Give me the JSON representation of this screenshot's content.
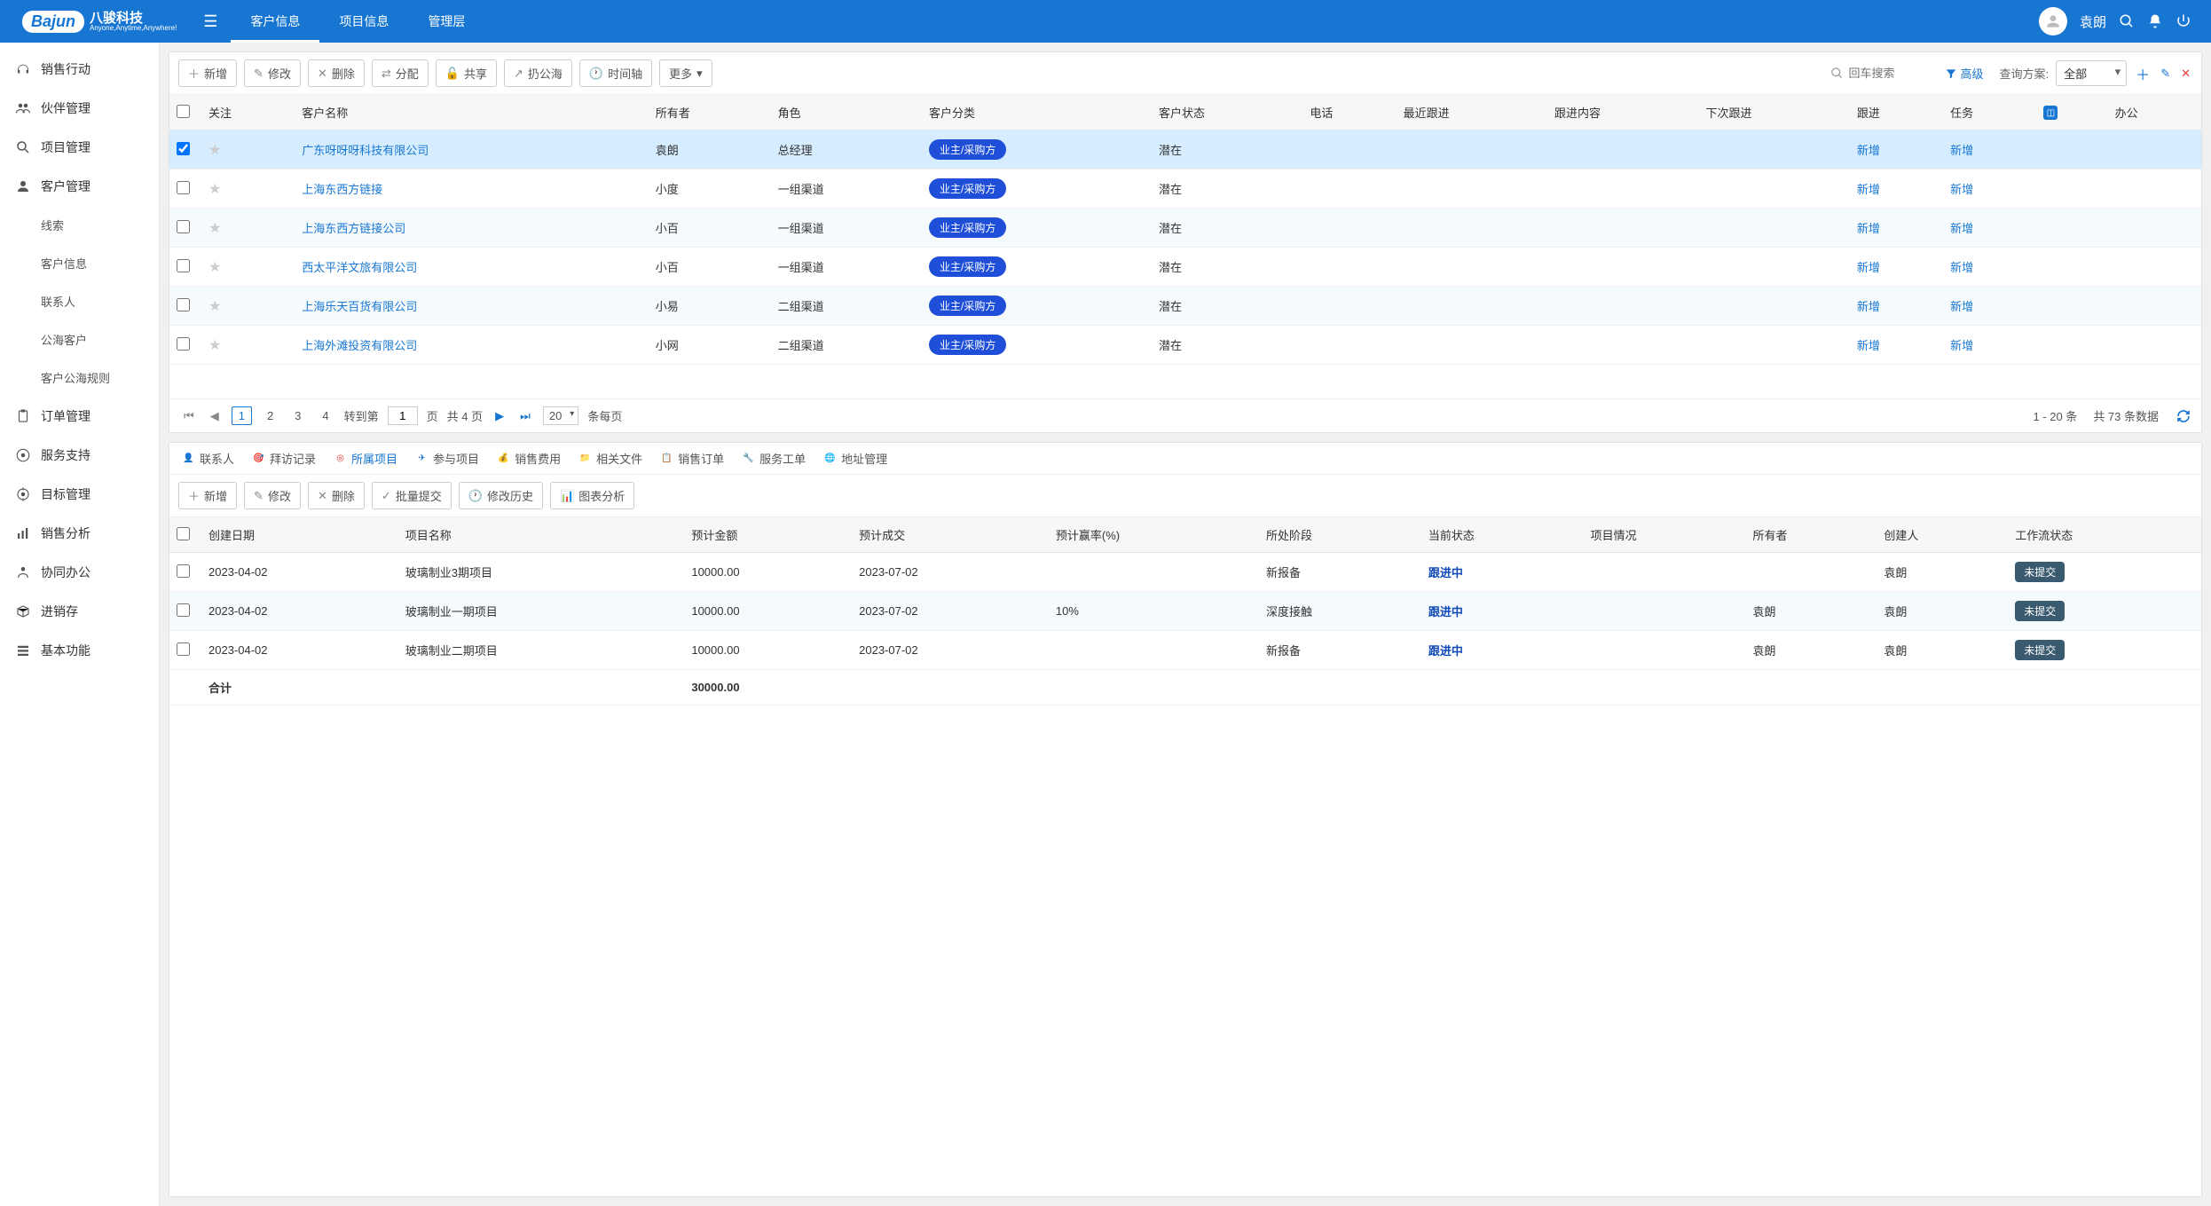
{
  "header": {
    "logo_brand": "Bajun",
    "logo_cn": "八骏科技",
    "logo_en": "Anyone,Anytime,Anywhere!",
    "nav": [
      "客户信息",
      "项目信息",
      "管理层"
    ],
    "active_nav": 0,
    "username": "袁朗"
  },
  "sidebar": {
    "items": [
      {
        "icon": "headset",
        "label": "销售行动"
      },
      {
        "icon": "users",
        "label": "伙伴管理"
      },
      {
        "icon": "search-doc",
        "label": "项目管理"
      },
      {
        "icon": "user",
        "label": "客户管理",
        "expanded": true,
        "children": [
          "线索",
          "客户信息",
          "联系人",
          "公海客户",
          "客户公海规则"
        ]
      },
      {
        "icon": "clipboard",
        "label": "订单管理"
      },
      {
        "icon": "support",
        "label": "服务支持"
      },
      {
        "icon": "target",
        "label": "目标管理"
      },
      {
        "icon": "chart",
        "label": "销售分析"
      },
      {
        "icon": "collab",
        "label": "协同办公"
      },
      {
        "icon": "stock",
        "label": "进销存"
      },
      {
        "icon": "basic",
        "label": "基本功能"
      }
    ]
  },
  "toolbar": {
    "buttons": [
      {
        "icon": "plus",
        "label": "新增"
      },
      {
        "icon": "pencil",
        "label": "修改"
      },
      {
        "icon": "x",
        "label": "删除"
      },
      {
        "icon": "share",
        "label": "分配"
      },
      {
        "icon": "lock-open",
        "label": "共享"
      },
      {
        "icon": "external",
        "label": "扔公海"
      },
      {
        "icon": "clock",
        "label": "时间轴"
      }
    ],
    "more": "更多",
    "search_placeholder": "回车搜索",
    "filter": "高级",
    "query_label": "查询方案:",
    "query_value": "全部"
  },
  "table": {
    "columns": [
      "关注",
      "客户名称",
      "所有者",
      "角色",
      "客户分类",
      "客户状态",
      "电话",
      "最近跟进",
      "跟进内容",
      "下次跟进",
      "跟进",
      "任务",
      "",
      "办公"
    ],
    "rows": [
      {
        "checked": true,
        "name": "广东呀呀呀科技有限公司",
        "owner": "袁朗",
        "role": "总经理",
        "cat": "业主/采购方",
        "status": "潜在",
        "follow": "新增",
        "task": "新增"
      },
      {
        "checked": false,
        "name": "上海东西方链接",
        "owner": "小度",
        "role": "一组渠道",
        "cat": "业主/采购方",
        "status": "潜在",
        "follow": "新增",
        "task": "新增"
      },
      {
        "checked": false,
        "name": "上海东西方链接公司",
        "owner": "小百",
        "role": "一组渠道",
        "cat": "业主/采购方",
        "status": "潜在",
        "follow": "新增",
        "task": "新增"
      },
      {
        "checked": false,
        "name": "西太平洋文旅有限公司",
        "owner": "小百",
        "role": "一组渠道",
        "cat": "业主/采购方",
        "status": "潜在",
        "follow": "新增",
        "task": "新增"
      },
      {
        "checked": false,
        "name": "上海乐天百货有限公司",
        "owner": "小易",
        "role": "二组渠道",
        "cat": "业主/采购方",
        "status": "潜在",
        "follow": "新增",
        "task": "新增"
      },
      {
        "checked": false,
        "name": "上海外滩投资有限公司",
        "owner": "小网",
        "role": "二组渠道",
        "cat": "业主/采购方",
        "status": "潜在",
        "follow": "新增",
        "task": "新增"
      }
    ]
  },
  "pager": {
    "pages": [
      "1",
      "2",
      "3",
      "4"
    ],
    "active": 0,
    "goto_label": "转到第",
    "goto_val": "1",
    "goto_suffix": "页",
    "total_pages": "共 4 页",
    "page_size": "20",
    "page_size_suffix": "条每页",
    "range": "1 - 20 条",
    "total": "共 73 条数据"
  },
  "detail_tabs": [
    {
      "icon": "👤",
      "color": "#f5a623",
      "label": "联系人"
    },
    {
      "icon": "🎯",
      "color": "#4caf50",
      "label": "拜访记录"
    },
    {
      "icon": "◎",
      "color": "#e53935",
      "label": "所属项目",
      "active": true
    },
    {
      "icon": "✈",
      "color": "#1776d2",
      "label": "参与项目"
    },
    {
      "icon": "💰",
      "color": "#ff9800",
      "label": "销售费用"
    },
    {
      "icon": "📁",
      "color": "#ffa726",
      "label": "相关文件"
    },
    {
      "icon": "📋",
      "color": "#9e9e9e",
      "label": "销售订单"
    },
    {
      "icon": "🔧",
      "color": "#795548",
      "label": "服务工单"
    },
    {
      "icon": "🌐",
      "color": "#4caf50",
      "label": "地址管理"
    }
  ],
  "detail_toolbar": [
    {
      "icon": "plus",
      "label": "新增"
    },
    {
      "icon": "pencil",
      "label": "修改"
    },
    {
      "icon": "x",
      "label": "删除"
    },
    {
      "icon": "check",
      "label": "批量提交"
    },
    {
      "icon": "clock",
      "label": "修改历史"
    },
    {
      "icon": "chart",
      "label": "图表分析"
    }
  ],
  "detail_table": {
    "columns": [
      "创建日期",
      "项目名称",
      "预计金额",
      "预计成交",
      "预计赢率(%)",
      "所处阶段",
      "当前状态",
      "项目情况",
      "所有者",
      "创建人",
      "工作流状态"
    ],
    "rows": [
      {
        "date": "2023-04-02",
        "name": "玻璃制业3期项目",
        "amount": "10000.00",
        "deal": "2023-07-02",
        "win": "",
        "stage": "新报备",
        "status": "跟进中",
        "info": "",
        "owner": "",
        "creator": "袁朗",
        "wf": "未提交"
      },
      {
        "date": "2023-04-02",
        "name": "玻璃制业一期项目",
        "amount": "10000.00",
        "deal": "2023-07-02",
        "win": "10%",
        "stage": "深度接触",
        "status": "跟进中",
        "info": "",
        "owner": "袁朗",
        "creator": "袁朗",
        "wf": "未提交"
      },
      {
        "date": "2023-04-02",
        "name": "玻璃制业二期项目",
        "amount": "10000.00",
        "deal": "2023-07-02",
        "win": "",
        "stage": "新报备",
        "status": "跟进中",
        "info": "",
        "owner": "袁朗",
        "creator": "袁朗",
        "wf": "未提交"
      }
    ],
    "total_label": "合计",
    "total_amount": "30000.00"
  }
}
